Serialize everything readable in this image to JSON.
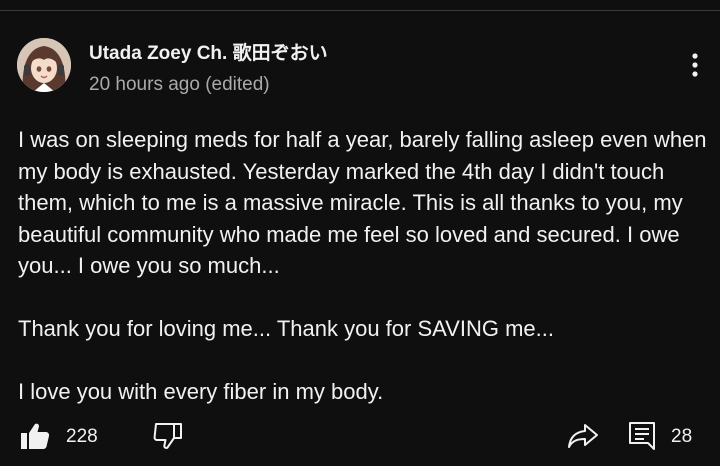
{
  "comment": {
    "author": "Utada Zoey Ch. 歌田ぞおい",
    "timestamp": "20 hours ago (edited)",
    "paragraphs": [
      "I was on sleeping meds for half a year, barely falling asleep even when my body is exhausted. Yesterday marked the 4th day I didn't touch them, which to me is a massive miracle. This is all thanks to you, my beautiful community who made me feel so loved and secured. I owe you... I owe you so much...",
      "Thank you for loving me... Thank you for SAVING me...",
      "I love you with every fiber in my body."
    ],
    "like_count": "228",
    "reply_count": "28"
  },
  "icons": {
    "avatar": "avatar-image",
    "more": "more-vertical-icon",
    "like": "thumb-up-filled-icon",
    "dislike": "thumb-down-outline-icon",
    "share": "share-arrow-icon",
    "reply": "comment-reply-icon"
  },
  "colors": {
    "background": "#0f0f0f",
    "text_primary": "#f1f1f1",
    "text_secondary": "#aaaaaa"
  }
}
